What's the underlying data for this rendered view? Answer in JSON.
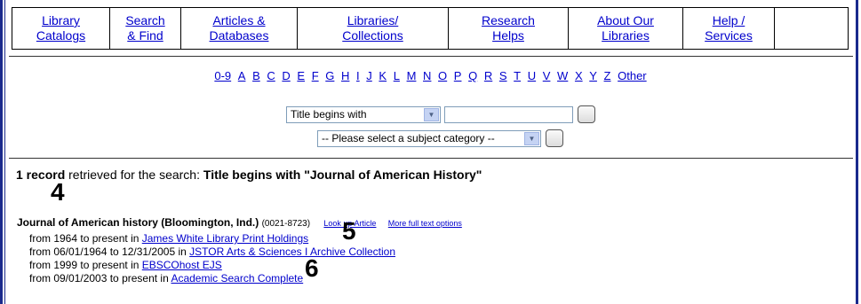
{
  "nav": [
    {
      "label": "Library\nCatalogs"
    },
    {
      "label": "Search\n& Find"
    },
    {
      "label": "Articles &\nDatabases"
    },
    {
      "label": "Libraries/\nCollections"
    },
    {
      "label": "Research\nHelps"
    },
    {
      "label": "About Our\nLibraries"
    },
    {
      "label": "Help /\nServices"
    },
    {
      "label": ""
    }
  ],
  "alphabet": [
    "0-9",
    "A",
    "B",
    "C",
    "D",
    "E",
    "F",
    "G",
    "H",
    "I",
    "J",
    "K",
    "L",
    "M",
    "N",
    "O",
    "P",
    "Q",
    "R",
    "S",
    "T",
    "U",
    "V",
    "W",
    "X",
    "Y",
    "Z",
    "Other"
  ],
  "search": {
    "type_selected": "Title begins with",
    "query_value": "",
    "subject_selected": "-- Please select a subject category --"
  },
  "results": {
    "count_label": "1 record",
    "retrieved_text": " retrieved for the search: ",
    "query_label": "Title begins with \"Journal of American History\""
  },
  "record": {
    "title": "Journal of American history (Bloomington, Ind.)",
    "issn": "(0021-8723)",
    "lookup_link": "Look up Article",
    "more_link": "More full text options",
    "holdings": [
      {
        "range": "from 1964 to present in ",
        "source": "James White Library Print Holdings"
      },
      {
        "range": "from 06/01/1964 to 12/31/2005 in ",
        "source": "JSTOR Arts & Sciences I Archive Collection"
      },
      {
        "range": "from 1999 to present in ",
        "source": "EBSCOhost EJS"
      },
      {
        "range": "from 09/01/2003 to present in ",
        "source": "Academic Search Complete"
      }
    ]
  },
  "callouts": {
    "c4": "4",
    "c5": "5",
    "c6": "6"
  }
}
